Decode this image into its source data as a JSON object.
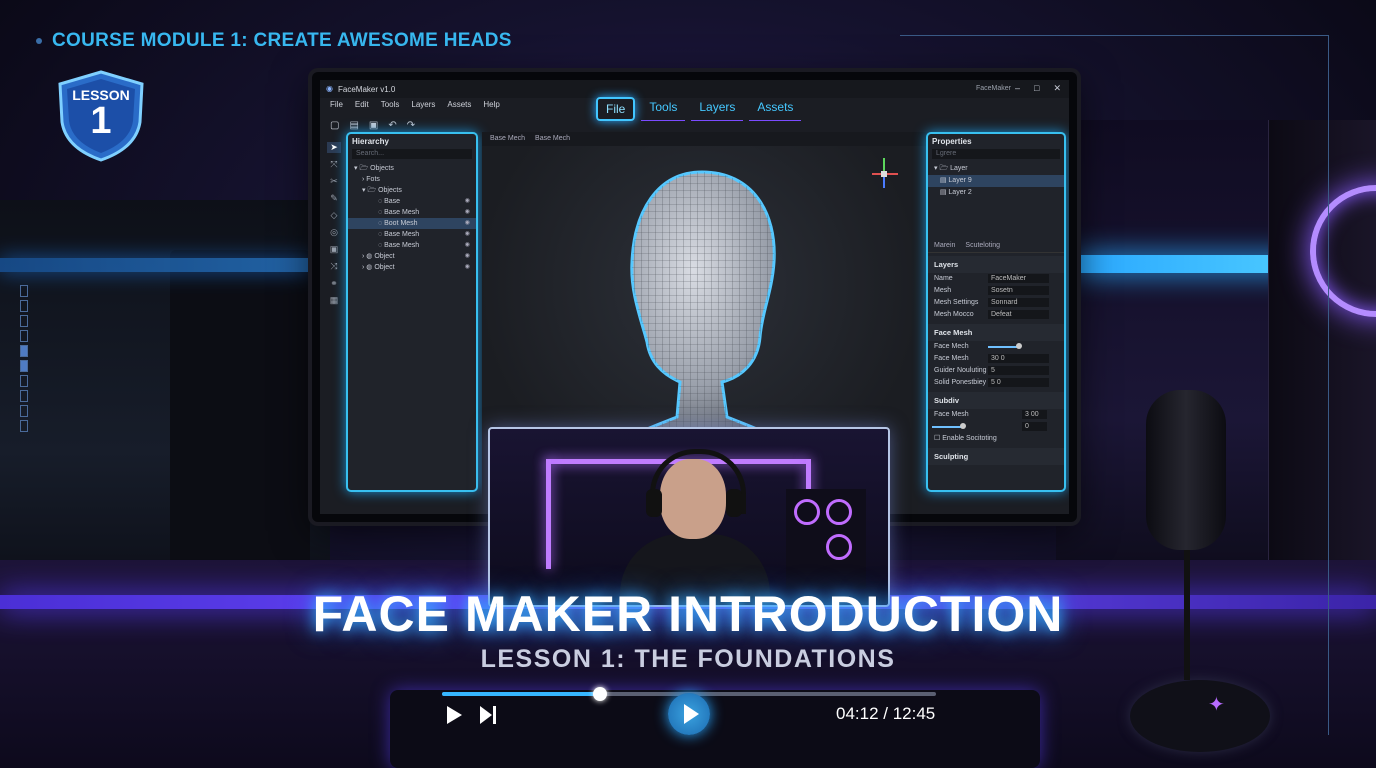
{
  "course": {
    "module_title": "COURSE MODULE 1: CREATE AWESOME HEADS"
  },
  "badge": {
    "label": "LESSON",
    "number": "1"
  },
  "app": {
    "window_title": "FaceMaker v1.0",
    "brand_right": "FaceMaker",
    "menu": [
      "File",
      "Edit",
      "Tools",
      "Layers",
      "Assets",
      "Help"
    ],
    "big_menu": [
      "File",
      "Tools",
      "Layers",
      "Assets"
    ],
    "big_menu_active": "File"
  },
  "hierarchy": {
    "title": "Hierarchy",
    "search_placeholder": "Search...",
    "rows": [
      {
        "label": "Objects",
        "indent": 0,
        "sel": false,
        "eye": false
      },
      {
        "label": "Fots",
        "indent": 1,
        "sel": false,
        "eye": false
      },
      {
        "label": "Objects",
        "indent": 1,
        "sel": false,
        "eye": false
      },
      {
        "label": "Base",
        "indent": 2,
        "sel": false,
        "eye": true
      },
      {
        "label": "Base Mesh",
        "indent": 2,
        "sel": false,
        "eye": true
      },
      {
        "label": "Boot Mesh",
        "indent": 2,
        "sel": true,
        "eye": true
      },
      {
        "label": "Base Mesh",
        "indent": 2,
        "sel": false,
        "eye": true
      },
      {
        "label": "Base Mesh",
        "indent": 2,
        "sel": false,
        "eye": true
      },
      {
        "label": "Object",
        "indent": 1,
        "sel": false,
        "eye": true
      },
      {
        "label": "Object",
        "indent": 1,
        "sel": false,
        "eye": true
      }
    ]
  },
  "viewport": {
    "tabs": [
      "Base Mech",
      "Base Mech"
    ]
  },
  "properties": {
    "title": "Properties",
    "dropdown": "Lgrere",
    "layers": [
      {
        "label": "Layer",
        "sel": false
      },
      {
        "label": "Layer 9",
        "sel": true
      },
      {
        "label": "Layer 2",
        "sel": false
      }
    ],
    "tabs": [
      "Marein",
      "Scuteloting"
    ],
    "section_layers": "Layers",
    "layer_fields": [
      {
        "label": "Name",
        "value": "FaceMaker"
      },
      {
        "label": "Mesh",
        "value": "Sosetn"
      },
      {
        "label": "Mesh Settings",
        "value": "Sonnard"
      },
      {
        "label": "Mesh Mocco",
        "value": "Defeat"
      }
    ],
    "section_face": "Face Mesh",
    "face_fields": [
      {
        "label": "Face Mech",
        "value": ""
      },
      {
        "label": "Face Mesh",
        "value": "30 0"
      },
      {
        "label": "Guider Nouluting",
        "value": "5"
      },
      {
        "label": "Solid Ponestbiey",
        "value": "5 0"
      }
    ],
    "section_subdiv": "Subdiv",
    "subdiv_fields": [
      {
        "label": "Face Mesh",
        "value": "3 00"
      },
      {
        "label": "",
        "value": "0"
      }
    ],
    "subdiv_check": "Enable Socitoting",
    "section_sculpt": "Sculpting"
  },
  "video": {
    "title": "FACE MAKER INTRODUCTION",
    "subtitle": "LESSON 1: THE FOUNDATIONS",
    "time": "04:12 / 12:45",
    "progress": 0.32
  },
  "colors": {
    "accent": "#38c0f0",
    "purple": "#7b4bff"
  }
}
